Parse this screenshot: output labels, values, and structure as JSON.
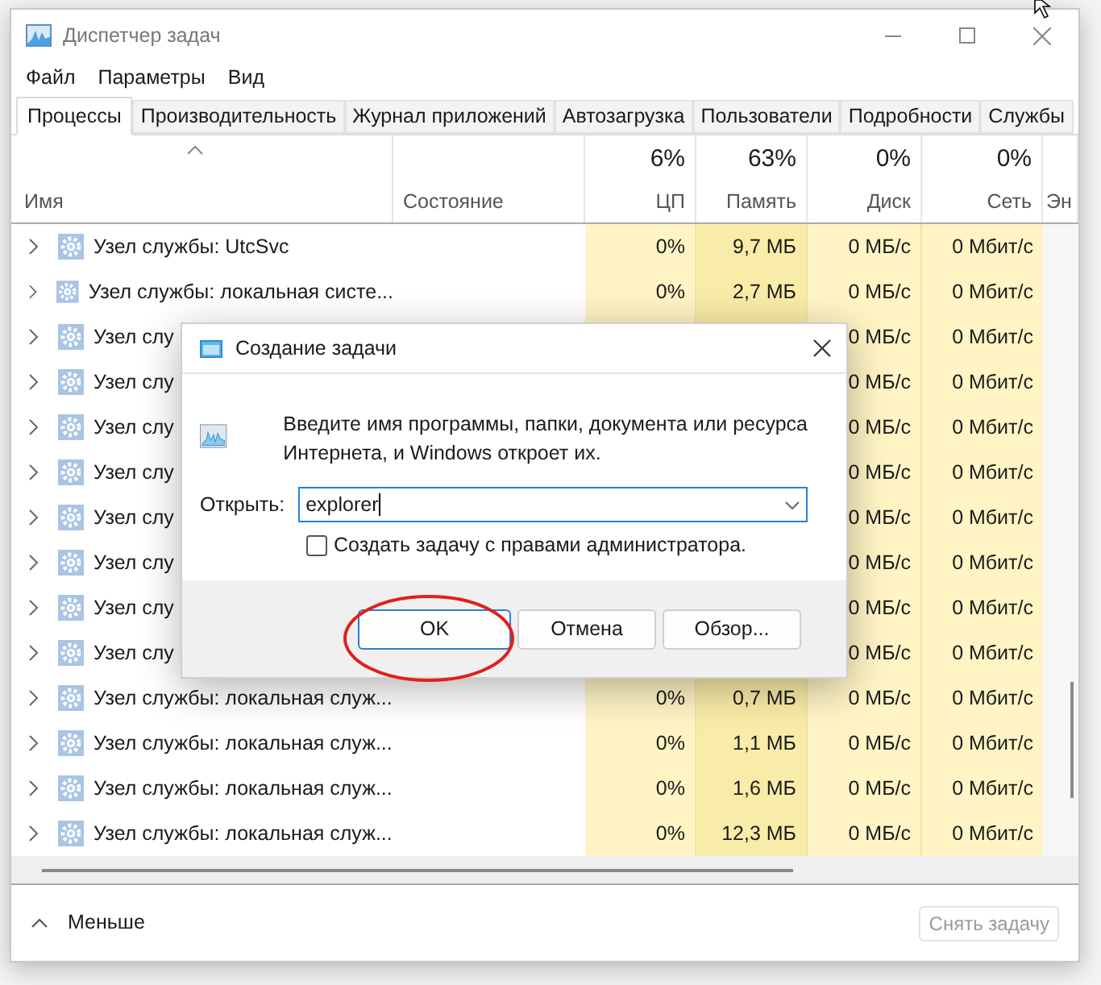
{
  "window": {
    "title": "Диспетчер задач"
  },
  "menu": [
    "Файл",
    "Параметры",
    "Вид"
  ],
  "tabs": [
    {
      "label": "Процессы",
      "selected": true
    },
    {
      "label": "Производительность",
      "selected": false
    },
    {
      "label": "Журнал приложений",
      "selected": false
    },
    {
      "label": "Автозагрузка",
      "selected": false
    },
    {
      "label": "Пользователи",
      "selected": false
    },
    {
      "label": "Подробности",
      "selected": false
    },
    {
      "label": "Службы",
      "selected": false
    }
  ],
  "table": {
    "columns": [
      {
        "name": "Имя",
        "kind": "name"
      },
      {
        "name": "Состояние",
        "kind": "status"
      },
      {
        "name": "ЦП",
        "total": "6%",
        "kind": "cpu"
      },
      {
        "name": "Память",
        "total": "63%",
        "kind": "memory"
      },
      {
        "name": "Диск",
        "total": "0%",
        "kind": "disk"
      },
      {
        "name": "Сеть",
        "total": "0%",
        "kind": "network"
      },
      {
        "name": "Эн",
        "kind": "cut"
      }
    ],
    "rows": [
      {
        "name": "Узел службы: UtcSvc",
        "cpu": "0%",
        "memory": "9,7 МБ",
        "disk": "0 МБ/с",
        "network": "0 Мбит/с"
      },
      {
        "name": "Узел службы: локальная систе...",
        "cpu": "0%",
        "memory": "2,7 МБ",
        "disk": "0 МБ/с",
        "network": "0 Мбит/с"
      },
      {
        "name": "Узел слу",
        "disk": "0 МБ/с",
        "network": "0 Мбит/с"
      },
      {
        "name": "Узел слу",
        "disk": "0 МБ/с",
        "network": "0 Мбит/с"
      },
      {
        "name": "Узел слу",
        "disk": "0 МБ/с",
        "network": "0 Мбит/с"
      },
      {
        "name": "Узел слу",
        "disk": "0 МБ/с",
        "network": "0 Мбит/с"
      },
      {
        "name": "Узел слу",
        "disk": "0 МБ/с",
        "network": "0 Мбит/с"
      },
      {
        "name": "Узел слу",
        "disk": "0 МБ/с",
        "network": "0 Мбит/с"
      },
      {
        "name": "Узел слу",
        "disk": "0 МБ/с",
        "network": "0 Мбит/с"
      },
      {
        "name": "Узел слу",
        "disk": "0 МБ/с",
        "network": "0 Мбит/с"
      },
      {
        "name": "Узел службы: локальная служ...",
        "cpu": "0%",
        "memory": "0,7 МБ",
        "disk": "0 МБ/с",
        "network": "0 Мбит/с"
      },
      {
        "name": "Узел службы: локальная служ...",
        "cpu": "0%",
        "memory": "1,1 МБ",
        "disk": "0 МБ/с",
        "network": "0 Мбит/с"
      },
      {
        "name": "Узел службы: локальная служ...",
        "cpu": "0%",
        "memory": "1,6 МБ",
        "disk": "0 МБ/с",
        "network": "0 Мбит/с"
      },
      {
        "name": "Узел службы: локальная служ...",
        "cpu": "0%",
        "memory": "12,3 МБ",
        "disk": "0 МБ/с",
        "network": "0 Мбит/с"
      }
    ]
  },
  "footer": {
    "toggle": "Меньше",
    "end_task": {
      "label": "Снять задачу",
      "disabled": true
    }
  },
  "dialog": {
    "title": "Создание задачи",
    "message_lines": [
      "Введите имя программы, папки, документа или ресурса",
      "Интернета, и Windows откроет их."
    ],
    "open_label": "Открыть:",
    "value": "explorer",
    "admin_checkbox": {
      "label": "Создать задачу с правами администратора.",
      "checked": false
    },
    "buttons": [
      {
        "label": "OK",
        "kind": "default"
      },
      {
        "label": "Отмена",
        "kind": "normal"
      },
      {
        "label": "Обзор...",
        "kind": "normal"
      }
    ]
  }
}
